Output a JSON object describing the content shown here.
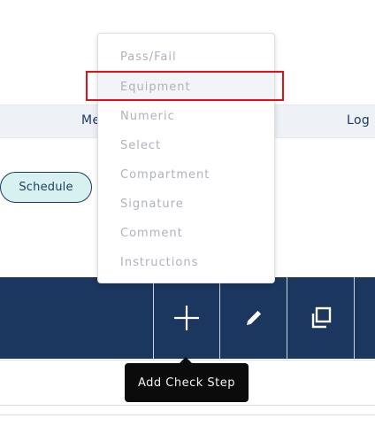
{
  "header": {
    "left_label": "Me",
    "right_label": "Log I"
  },
  "schedule_button": {
    "label": "Schedule"
  },
  "menu": {
    "items": [
      {
        "label": "Pass/Fail"
      },
      {
        "label": "Equipment"
      },
      {
        "label": "Numeric"
      },
      {
        "label": "Select"
      },
      {
        "label": "Compartment"
      },
      {
        "label": "Signature"
      },
      {
        "label": "Comment"
      },
      {
        "label": "Instructions"
      }
    ],
    "highlighted_item": "Equipment"
  },
  "toolbar": {
    "buttons": [
      {
        "icon": "plus-icon"
      },
      {
        "icon": "pencil-icon"
      },
      {
        "icon": "copy-icon"
      }
    ]
  },
  "tooltip": {
    "text": "Add Check Step"
  },
  "colors": {
    "toolbar_bg": "#1b375f",
    "schedule_bg": "#d7f1f1",
    "highlight_border": "#e3101a",
    "tooltip_bg": "#0b0b0b",
    "menu_text": "#aeb3bb"
  }
}
